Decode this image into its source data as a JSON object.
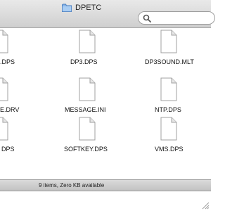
{
  "window": {
    "title": "DPETC"
  },
  "search": {
    "value": "",
    "placeholder": ""
  },
  "files": [
    {
      "name": ".DPS"
    },
    {
      "name": "DP3.DPS"
    },
    {
      "name": "DP3SOUND.MLT"
    },
    {
      "name": "E.DRV"
    },
    {
      "name": "MESSAGE.INI"
    },
    {
      "name": "NTP.DPS"
    },
    {
      "name": "DPS"
    },
    {
      "name": "SOFTKEY.DPS"
    },
    {
      "name": "VMS.DPS"
    }
  ],
  "status": {
    "text": "9 items, Zero KB available"
  },
  "icons": {
    "window_icon": "folder-icon",
    "search_icon": "search-icon",
    "file_icon": "document-icon",
    "resize_icon": "resize-grip-icon"
  }
}
